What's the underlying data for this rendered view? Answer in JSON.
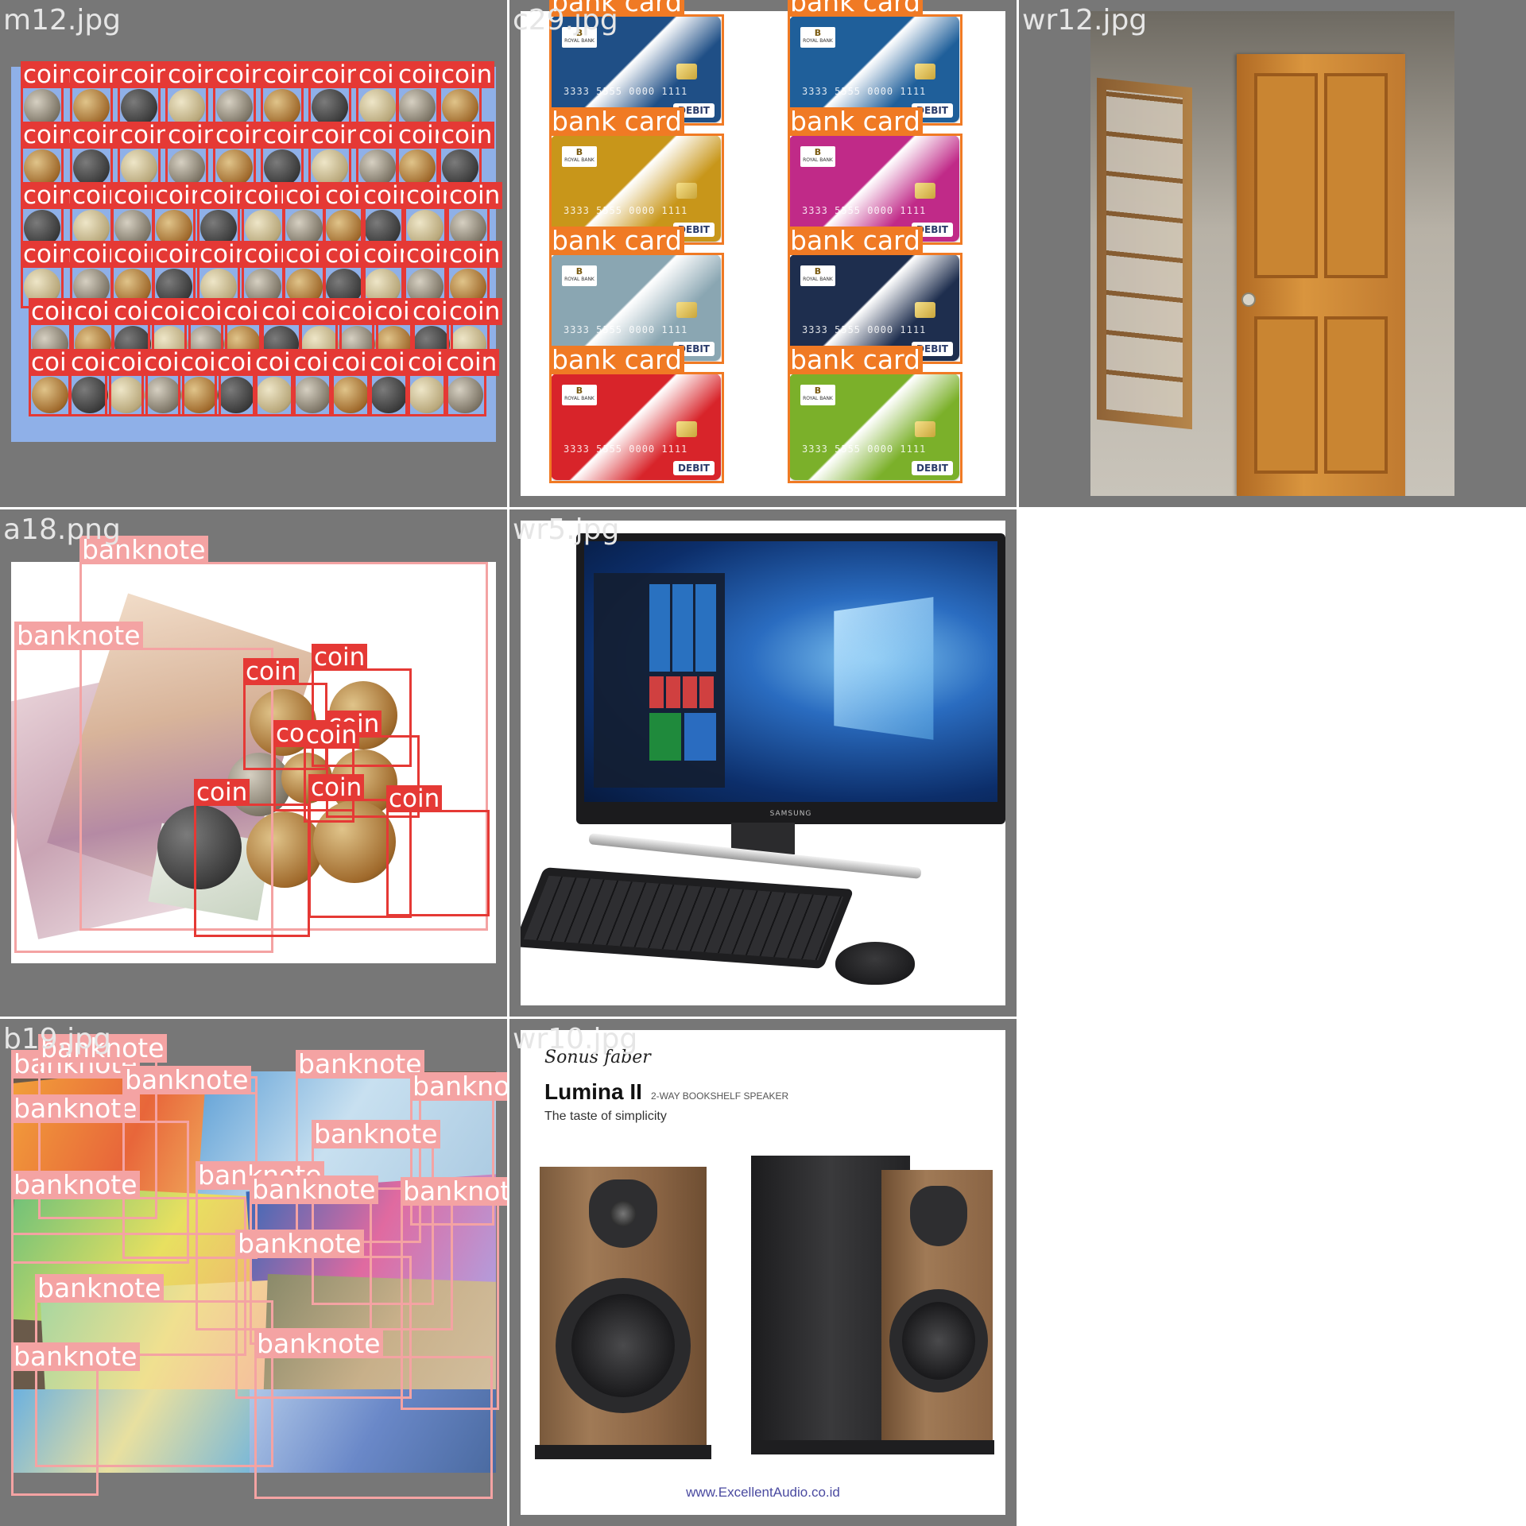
{
  "tiles": [
    {
      "name": "m12.jpg",
      "labels": {
        "coin": "coin"
      }
    },
    {
      "name": "c29.jpg",
      "labels": {
        "card": "bank card"
      }
    },
    {
      "name": "wr12.jpg"
    },
    {
      "name": "a18.png",
      "labels": {
        "banknote": "banknote",
        "coin": "coin"
      }
    },
    {
      "name": "wr5.jpg"
    },
    {
      "name": "b19.jpg",
      "labels": {
        "banknote": "banknote"
      }
    },
    {
      "name": "wr10.jpg"
    }
  ],
  "cards": {
    "bank_name": "ROYAL BANK",
    "logo_letter": "B",
    "number": "3333  5555  0000  1111",
    "debit": "DEBIT",
    "colors": [
      "#1f4f86",
      "#1f5f9a",
      "#c8961a",
      "#c02a88",
      "#8aa6b2",
      "#1e2e4e",
      "#d8242a",
      "#7bb02a"
    ]
  },
  "speaker_ad": {
    "brand": "Sonus faber",
    "product": "Lumina II",
    "product_sub": "2-WAY BOOKSHELF SPEAKER",
    "tagline": "The taste of simplicity",
    "website": "www.ExcellentAudio.co.id"
  },
  "monitor": {
    "brand": "SAMSUNG"
  },
  "colors": {
    "coin_box": "#e53935",
    "card_box": "#f07a24",
    "banknote_box": "#f4a3a3",
    "tile_bg": "#777777"
  }
}
